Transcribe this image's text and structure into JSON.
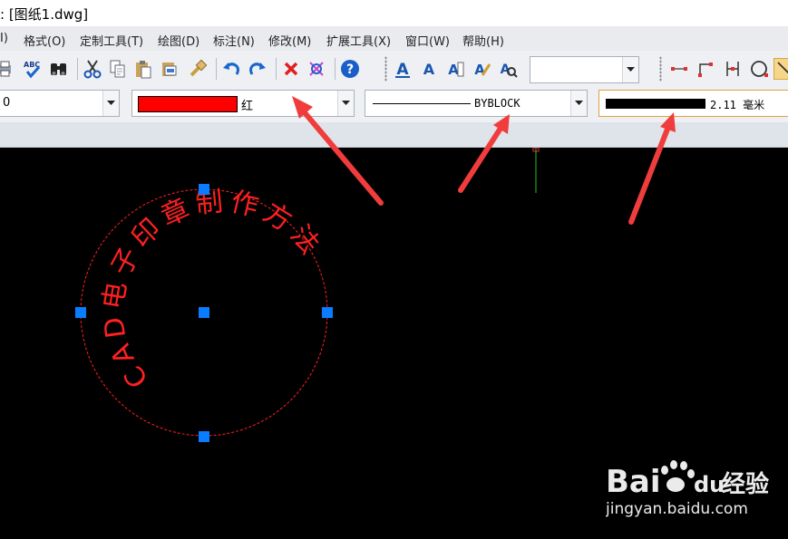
{
  "window": {
    "title": ": [图纸1.dwg]"
  },
  "menu": {
    "items": [
      "I)",
      "格式(O)",
      "定制工具(T)",
      "绘图(D)",
      "标注(N)",
      "修改(M)",
      "扩展工具(X)",
      "窗口(W)",
      "帮助(H)"
    ]
  },
  "toolbar": {
    "icons": [
      "print-preview-icon",
      "spell-check-icon",
      "find-icon",
      "cut-icon",
      "copy-icon",
      "paste-icon",
      "paste-special-icon",
      "match-properties-icon",
      "undo-icon",
      "redo-icon",
      "erase-icon",
      "explode-icon",
      "help-icon",
      "text-style-icon",
      "text-icon",
      "text-edit-icon",
      "text-scale-icon",
      "find-text-icon",
      "dimension-icon",
      "ordinate-icon",
      "aligned-dim-icon",
      "circle-icon",
      "line-icon"
    ],
    "style_combo_value": ""
  },
  "properties": {
    "layer_value": "0",
    "color_name": "红",
    "color_hex": "#ff0000",
    "linetype_value": "BYBLOCK",
    "lineweight_value": "2.11 毫米"
  },
  "drawing": {
    "seal_text": "CAD电子印章制作方法",
    "seal_color": "#ff2020",
    "grip_color": "#0a7cff"
  },
  "watermark": {
    "brand_bai": "Bai",
    "brand_du": "du",
    "brand_cn": "经验",
    "url": "jingyan.baidu.com"
  }
}
